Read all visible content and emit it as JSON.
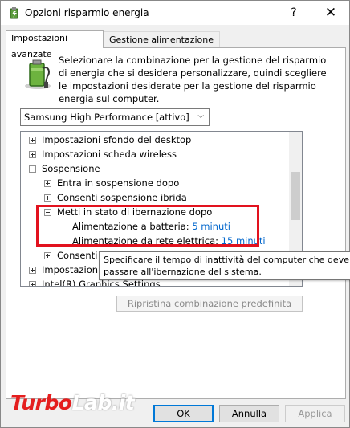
{
  "window": {
    "title": "Opzioni risparmio energia",
    "help_glyph": "?",
    "close_glyph": "✕"
  },
  "tabs": [
    {
      "label": "Impostazioni avanzate",
      "active": true
    },
    {
      "label": "Gestione alimentazione VAIO",
      "active": false
    }
  ],
  "description": "Selezionare la combinazione per la gestione del risparmio di energia che si desidera personalizzare, quindi scegliere le impostazioni desiderate per la gestione del risparmio energia sul computer.",
  "plan_select": {
    "value": "Samsung High Performance [attivo]",
    "chevron": "⌵"
  },
  "tree": {
    "items": [
      {
        "label": "Impostazioni sfondo del desktop",
        "expander": "+"
      },
      {
        "label": "Impostazioni scheda wireless",
        "expander": "+"
      },
      {
        "label": "Sospensione",
        "expander": "-"
      },
      {
        "label": "Entra in sospensione dopo",
        "expander": "+"
      },
      {
        "label": "Consenti sospensione ibrida",
        "expander": "+"
      },
      {
        "label": "Metti in stato di ibernazione dopo",
        "expander": "-"
      },
      {
        "label": "Alimentazione a batteria:",
        "value": "5 minuti"
      },
      {
        "label": "Alimentazione da rete elettrica:",
        "value": "15 minuti"
      },
      {
        "label": "Consenti t",
        "expander": "+"
      },
      {
        "label": "Impostazioni",
        "expander": "+"
      },
      {
        "label": "Intel(R) Graphics Settings",
        "expander": "+"
      }
    ]
  },
  "tooltip": {
    "line1": "Specificare il tempo di inattività del computer che deve tra",
    "line2": "passare all'ibernazione del sistema."
  },
  "restore_button": "Ripristina combinazione predefinita",
  "watermark": {
    "part_a": "Turbo",
    "part_b": "Lab.it"
  },
  "buttons": {
    "ok": "OK",
    "cancel": "Annulla",
    "apply": "Applica"
  },
  "colors": {
    "highlight": "#e2121e",
    "link": "#0066cc",
    "ok_border": "#0078d7"
  }
}
